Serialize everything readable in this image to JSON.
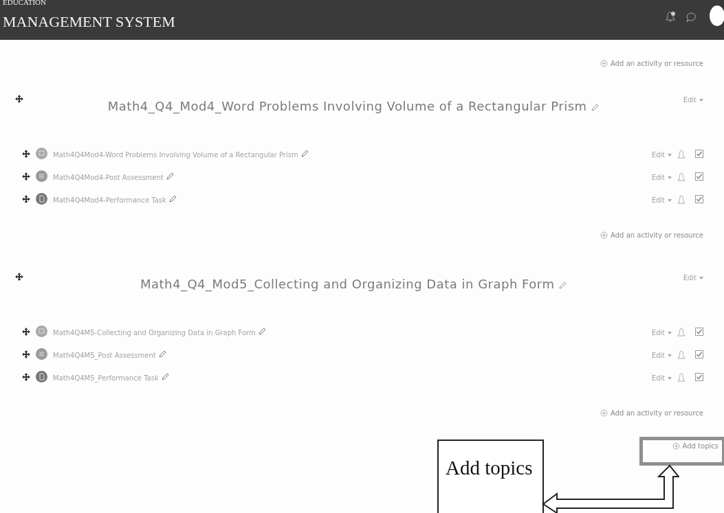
{
  "header": {
    "subtitle": "EDUCATION",
    "title": "MANAGEMENT SYSTEM"
  },
  "top_add_activity": "Add an activity or resource",
  "sections": [
    {
      "title": "Math4_Q4_Mod4_Word Problems Involving Volume of a Rectangular Prism",
      "edit": "Edit",
      "activities": [
        {
          "kind": "page",
          "name": "Math4Q4Mod4-Word Problems Involving Volume of a Rectangular Prism",
          "edit": "Edit",
          "completed": true
        },
        {
          "kind": "quiz",
          "name": "Math4Q4Mod4-Post Assessment",
          "edit": "Edit",
          "completed": true
        },
        {
          "kind": "assign",
          "name": "Math4Q4Mod4-Performance Task",
          "edit": "Edit",
          "completed": true
        }
      ],
      "add_activity": "Add an activity or resource"
    },
    {
      "title": "Math4_Q4_Mod5_Collecting and Organizing Data in Graph Form",
      "edit": "Edit",
      "activities": [
        {
          "kind": "page",
          "name": "Math4Q4M5-Collecting and Organizing Data in Graph Form",
          "edit": "Edit",
          "completed": true
        },
        {
          "kind": "quiz",
          "name": "Math4Q4M5_Post Assessment",
          "edit": "Edit",
          "completed": true
        },
        {
          "kind": "assign",
          "name": "Math4Q4M5_Performance Task",
          "edit": "Edit",
          "completed": true
        }
      ],
      "add_activity": "Add an activity or resource"
    }
  ],
  "add_topics": "Add topics",
  "callout": {
    "label": "Add topics"
  }
}
